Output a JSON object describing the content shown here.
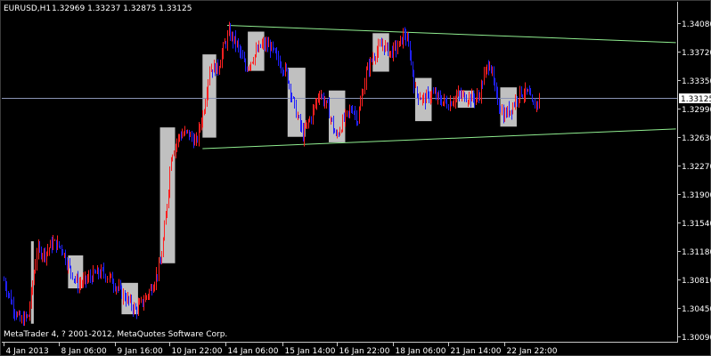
{
  "header": {
    "symbol_timeframe": "EURUSD,H1",
    "ohlc": "1.32969 1.33237 1.32875 1.33125"
  },
  "footer": {
    "copyright": "MetaTrader 4, ? 2001-2012, MetaQuotes Software Corp."
  },
  "colors": {
    "background": "#000000",
    "axis": "#c8c8c8",
    "bull_candle": "#ff2020",
    "bear_candle": "#2020ff",
    "zone_fill": "#c0c0c0",
    "trendline": "#90ee90",
    "current_price_line": "#8a93b5"
  },
  "price_axis": {
    "labels": [
      "1.34080",
      "1.33720",
      "1.33350",
      "1.32990",
      "1.32630",
      "1.32270",
      "1.31900",
      "1.31540",
      "1.31180",
      "1.30810",
      "1.30450",
      "1.30090"
    ],
    "current_price": "1.33125"
  },
  "time_axis": {
    "labels": [
      "4 Jan 2013",
      "8 Jan 06:00",
      "9 Jan 16:00",
      "10 Jan 22:00",
      "14 Jan 06:00",
      "15 Jan 14:00",
      "16 Jan 22:00",
      "18 Jan 06:00",
      "21 Jan 14:00",
      "22 Jan 22:00"
    ]
  },
  "chart_data": {
    "type": "candlestick",
    "timeframe": "H1",
    "ylim": [
      1.3002,
      1.3418
    ],
    "current_price": 1.33125,
    "zones": [
      {
        "bar": [
          20,
          22
        ],
        "price": [
          1.3025,
          1.313
        ]
      },
      {
        "bar": [
          47,
          58
        ],
        "price": [
          1.307,
          1.3112
        ]
      },
      {
        "bar": [
          86,
          98
        ],
        "price": [
          1.3037,
          1.3077
        ]
      },
      {
        "bar": [
          114,
          125
        ],
        "price": [
          1.3102,
          1.3275
        ]
      },
      {
        "bar": [
          145,
          155
        ],
        "price": [
          1.3262,
          1.3368
        ]
      },
      {
        "bar": [
          178,
          190
        ],
        "price": [
          1.3347,
          1.3397
        ]
      },
      {
        "bar": [
          207,
          220
        ],
        "price": [
          1.3263,
          1.3351
        ]
      },
      {
        "bar": [
          237,
          249
        ],
        "price": [
          1.3256,
          1.3322
        ]
      },
      {
        "bar": [
          269,
          281
        ],
        "price": [
          1.3346,
          1.3395
        ]
      },
      {
        "bar": [
          300,
          312
        ],
        "price": [
          1.3283,
          1.3338
        ]
      },
      {
        "bar": [
          331,
          343
        ],
        "price": [
          1.33,
          1.3322
        ]
      },
      {
        "bar": [
          362,
          374
        ],
        "price": [
          1.3276,
          1.3326
        ]
      }
    ],
    "trendlines": [
      {
        "bar": [
          163,
          490
        ],
        "price": [
          1.3405,
          1.3383
        ]
      },
      {
        "bar": [
          145,
          490
        ],
        "price": [
          1.3248,
          1.3273
        ]
      }
    ],
    "path": [
      [
        0,
        1.308
      ],
      [
        6,
        1.305
      ],
      [
        12,
        1.3028
      ],
      [
        18,
        1.3035
      ],
      [
        24,
        1.3118
      ],
      [
        30,
        1.3115
      ],
      [
        36,
        1.3128
      ],
      [
        42,
        1.3122
      ],
      [
        48,
        1.3095
      ],
      [
        54,
        1.3075
      ],
      [
        60,
        1.308
      ],
      [
        66,
        1.3088
      ],
      [
        72,
        1.309
      ],
      [
        78,
        1.3082
      ],
      [
        84,
        1.3068
      ],
      [
        90,
        1.3055
      ],
      [
        96,
        1.3042
      ],
      [
        102,
        1.3055
      ],
      [
        108,
        1.3072
      ],
      [
        114,
        1.31
      ],
      [
        118,
        1.316
      ],
      [
        122,
        1.324
      ],
      [
        128,
        1.3265
      ],
      [
        134,
        1.3268
      ],
      [
        140,
        1.3255
      ],
      [
        146,
        1.33
      ],
      [
        150,
        1.335
      ],
      [
        156,
        1.335
      ],
      [
        160,
        1.3375
      ],
      [
        164,
        1.3395
      ],
      [
        170,
        1.338
      ],
      [
        176,
        1.335
      ],
      [
        182,
        1.3365
      ],
      [
        188,
        1.338
      ],
      [
        194,
        1.3378
      ],
      [
        200,
        1.336
      ],
      [
        206,
        1.3345
      ],
      [
        212,
        1.33
      ],
      [
        218,
        1.3265
      ],
      [
        224,
        1.329
      ],
      [
        230,
        1.332
      ],
      [
        236,
        1.33
      ],
      [
        242,
        1.3262
      ],
      [
        248,
        1.3285
      ],
      [
        254,
        1.33
      ],
      [
        258,
        1.3285
      ],
      [
        264,
        1.3345
      ],
      [
        270,
        1.3368
      ],
      [
        276,
        1.338
      ],
      [
        282,
        1.337
      ],
      [
        288,
        1.338
      ],
      [
        292,
        1.3395
      ],
      [
        296,
        1.337
      ],
      [
        300,
        1.332
      ],
      [
        306,
        1.331
      ],
      [
        312,
        1.3318
      ],
      [
        318,
        1.331
      ],
      [
        324,
        1.3305
      ],
      [
        330,
        1.3315
      ],
      [
        336,
        1.3315
      ],
      [
        342,
        1.3312
      ],
      [
        346,
        1.3313
      ],
      [
        350,
        1.334
      ],
      [
        354,
        1.336
      ],
      [
        358,
        1.332
      ],
      [
        364,
        1.329
      ],
      [
        370,
        1.33
      ],
      [
        376,
        1.332
      ],
      [
        382,
        1.3318
      ],
      [
        386,
        1.33
      ],
      [
        390,
        1.3312
      ]
    ]
  }
}
